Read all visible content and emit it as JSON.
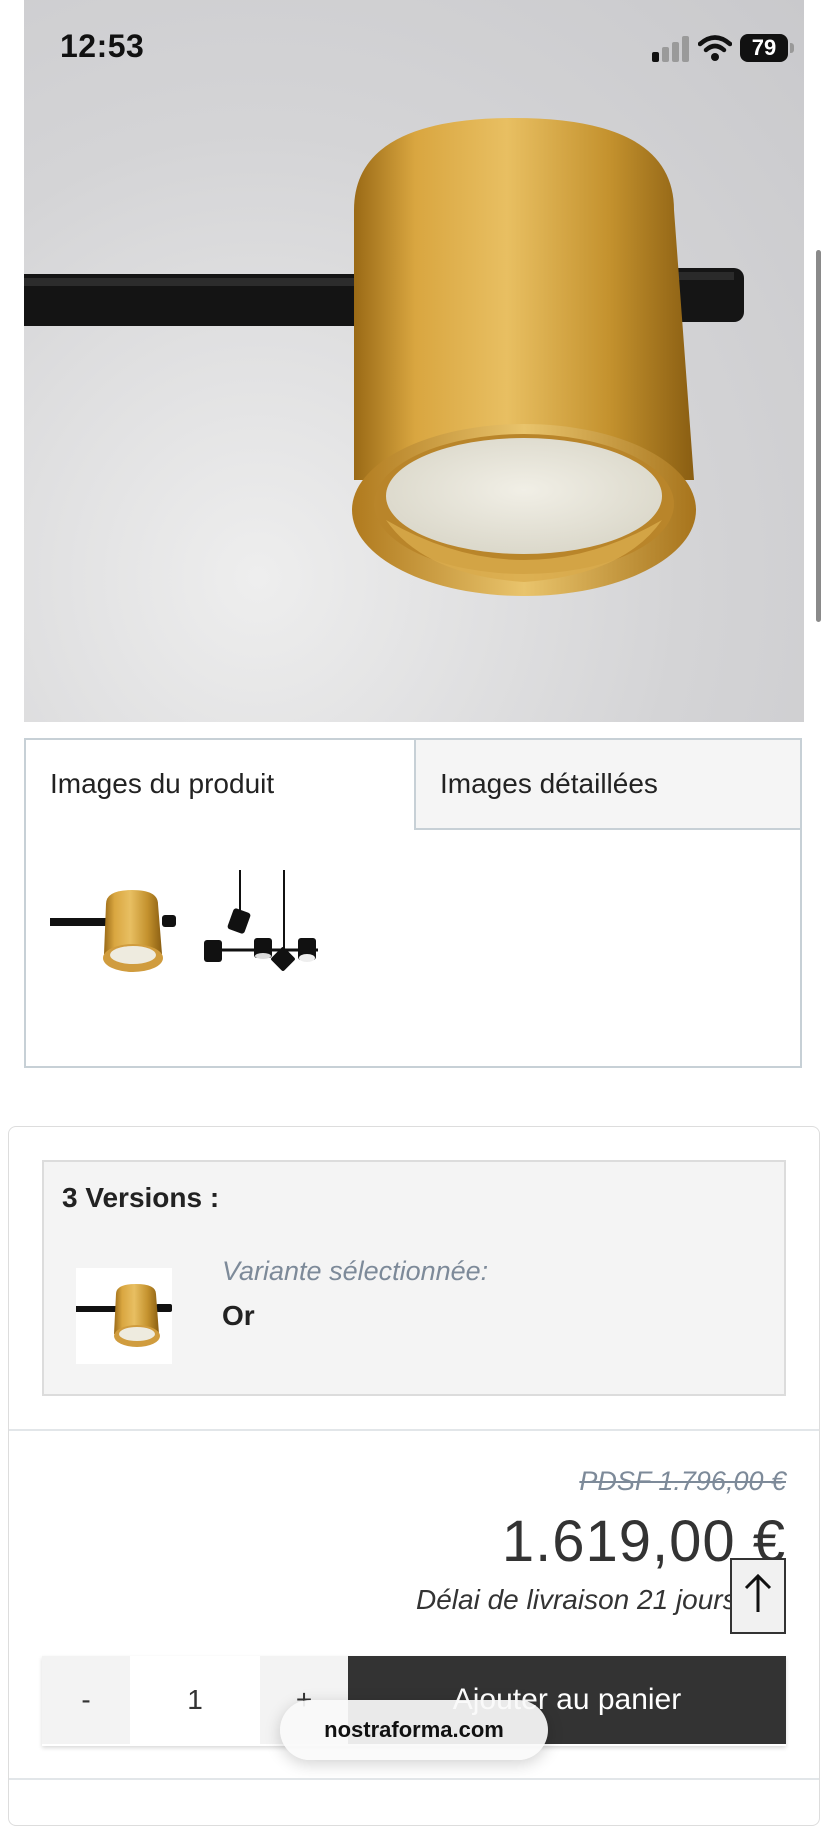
{
  "status_bar": {
    "time": "12:53",
    "battery": "79"
  },
  "gallery": {
    "tabs": [
      {
        "label": "Images du produit"
      },
      {
        "label": "Images détaillées"
      }
    ]
  },
  "variants": {
    "title": "3 Versions :",
    "caption": "Variante sélectionnée:",
    "selected": "Or"
  },
  "pricing": {
    "rrp": "PDSF 1.796,00 €",
    "price": "1.619,00 €",
    "delivery": "Délai de livraison 21 jours"
  },
  "cart": {
    "minus_label": "-",
    "quantity": "1",
    "plus_label": "+",
    "add_label": "Ajouter au panier"
  },
  "browser": {
    "url": "nostraforma.com"
  },
  "colors": {
    "brass": "#c8962e",
    "dark_button": "#333333",
    "muted_text": "#7d8a99"
  }
}
